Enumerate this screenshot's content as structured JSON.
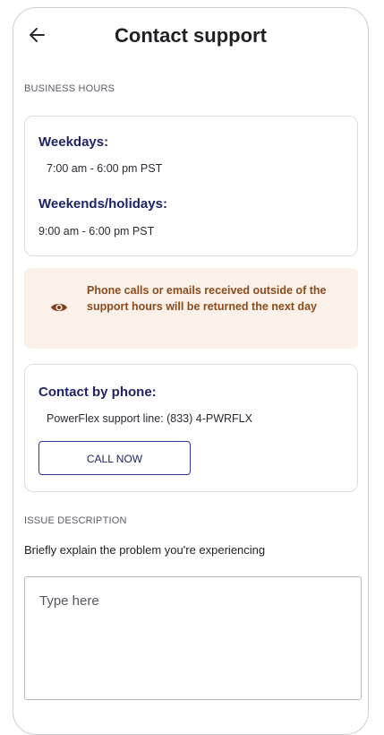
{
  "header": {
    "title": "Contact support",
    "back_icon": "arrow-left-icon"
  },
  "business_hours": {
    "section_label": "BUSINESS HOURS",
    "weekdays_heading": "Weekdays:",
    "weekdays_hours": "7:00 am - 6:00 pm PST",
    "weekends_heading": "Weekends/holidays:",
    "weekends_hours": "9:00 am - 6:00 pm PST"
  },
  "notice": {
    "icon": "eye-icon",
    "text": "Phone calls or emails received outside of the support hours will be returned the next day",
    "background_color": "#fbf1e8",
    "text_color": "#8a4b1e"
  },
  "phone_contact": {
    "heading": "Contact by phone:",
    "support_line": "PowerFlex support line: (833) 4-PWRFLX",
    "call_button_label": "CALL NOW"
  },
  "issue": {
    "section_label": "ISSUE DESCRIPTION",
    "prompt": "Briefly explain the problem you're experiencing",
    "placeholder": "Type here",
    "value": ""
  },
  "colors": {
    "heading_navy": "#1f2266",
    "border": "#dcdde3"
  }
}
